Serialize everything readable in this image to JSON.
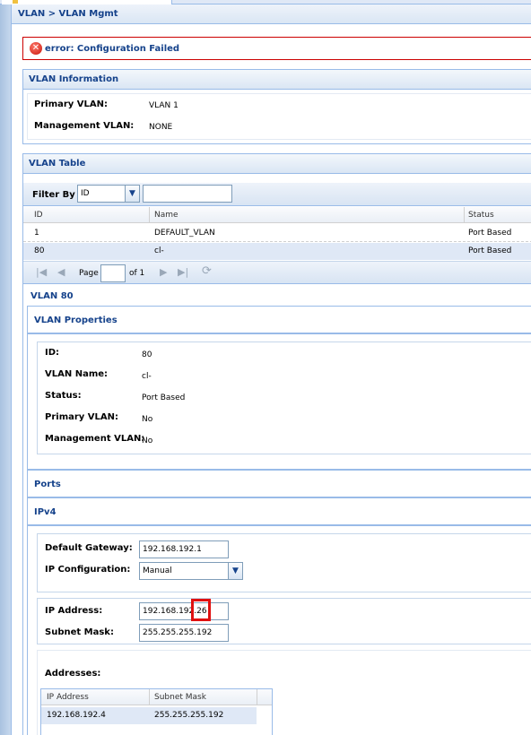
{
  "breadcrumb": "VLAN > VLAN Mgmt",
  "error": {
    "text": "error: Configuration Failed",
    "icon": "error-icon"
  },
  "vlan_info": {
    "title": "VLAN Information",
    "primary_label": "Primary VLAN:",
    "primary_value": "VLAN 1",
    "mgmt_label": "Management VLAN:",
    "mgmt_value": "NONE"
  },
  "vlan_table": {
    "title": "VLAN Table",
    "filter_label": "Filter By :",
    "filter_field": "ID",
    "filter_value": "",
    "columns": [
      "ID",
      "Name",
      "Status"
    ],
    "rows": [
      {
        "id": "1",
        "name": "DEFAULT_VLAN",
        "status": "Port Based"
      },
      {
        "id": "80",
        "name": "cl-",
        "status": "Port Based"
      }
    ],
    "pager": {
      "page_label": "Page",
      "page_value": "",
      "of_label": "of 1"
    }
  },
  "vlan_detail": {
    "title": "VLAN 80",
    "properties": {
      "title": "VLAN Properties",
      "id_label": "ID:",
      "id_value": "80",
      "name_label": "VLAN Name:",
      "name_value": "cl-",
      "status_label": "Status:",
      "status_value": "Port Based",
      "primary_label": "Primary VLAN:",
      "primary_value": "No",
      "mgmt_label": "Management VLAN:",
      "mgmt_value": "No"
    },
    "ports_title": "Ports",
    "ipv4": {
      "title": "IPv4",
      "gateway_label": "Default Gateway:",
      "gateway_value": "192.168.192.1",
      "ipconfig_label": "IP Configuration:",
      "ipconfig_value": "Manual",
      "ip_label": "IP Address:",
      "ip_value": "192.168.192.26",
      "mask_label": "Subnet Mask:",
      "mask_value": "255.255.255.192",
      "addresses_label": "Addresses:",
      "addr_columns": [
        "IP Address",
        "Subnet Mask"
      ],
      "addr_rows": [
        {
          "ip": "192.168.192.4",
          "mask": "255.255.255.192"
        }
      ]
    }
  },
  "colors": {
    "header_text": "#15428b",
    "border": "#99bbe8",
    "error": "#cc0000",
    "highlight": "#e01010",
    "selected_row": "#dfe8f6"
  }
}
